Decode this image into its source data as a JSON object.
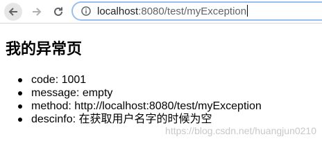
{
  "browser": {
    "url_host": "localhost",
    "url_rest": ":8080/test/myException"
  },
  "page": {
    "title": "我的异常页",
    "items": [
      {
        "key": "code",
        "value": "1001"
      },
      {
        "key": "message",
        "value": "empty"
      },
      {
        "key": "method",
        "value": "http://localhost:8080/test/myException"
      },
      {
        "key": "descinfo",
        "value": "在获取用户名字的时候为空"
      }
    ],
    "separator": ": "
  },
  "watermark": "https://blog.csdn.net/huangjun0210",
  "colors": {
    "omnibox_border": "#9bbcf2",
    "back_button_bg": "#e6e6e6"
  }
}
